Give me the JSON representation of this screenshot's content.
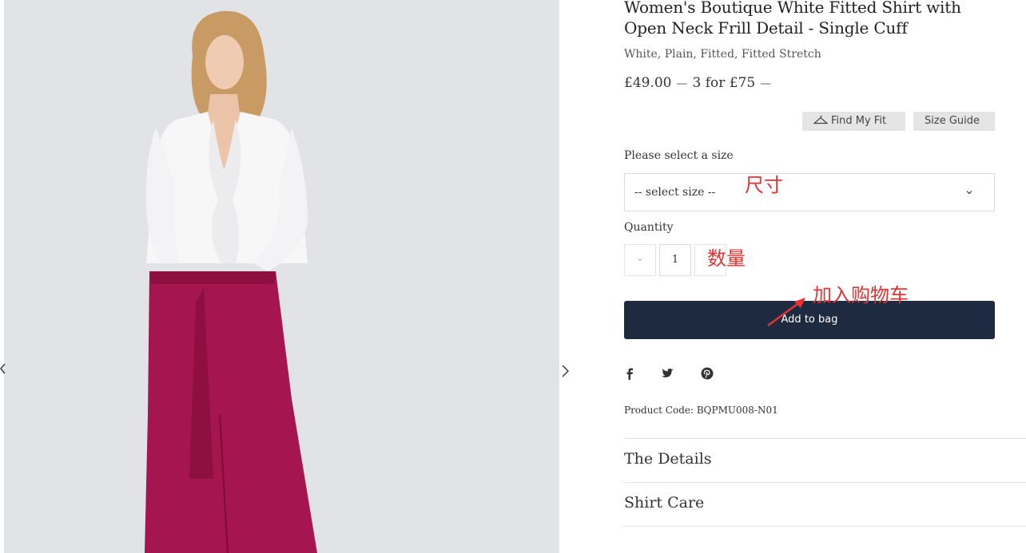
{
  "product": {
    "title": "Women's Boutique White Fitted Shirt with Open Neck Frill Detail - Single Cuff",
    "subtitle": "White, Plain, Fitted, Fitted Stretch",
    "price": "£49.00",
    "offer": "3 for £75",
    "dash": "—",
    "code": "Product Code: BQPMU008-N01"
  },
  "fit": {
    "find_my_fit": "Find My Fit",
    "size_guide": "Size Guide"
  },
  "size": {
    "label": "Please select a size",
    "placeholder": "-- select size --"
  },
  "quantity": {
    "label": "Quantity",
    "minus": "-",
    "value": "1",
    "plus": "+"
  },
  "cart": {
    "add_label": "Add to bag"
  },
  "social": [
    "facebook-icon",
    "twitter-icon",
    "pinterest-icon"
  ],
  "accordion": {
    "details": "The Details",
    "care": "Shirt Care"
  },
  "annotations": {
    "size": "尺寸",
    "quantity": "数量",
    "add_to_cart": "加入购物车"
  },
  "colors": {
    "button_navy": "#1e2a3f",
    "annotation_red": "#e63232",
    "image_bg": "#e2e3e7",
    "trousers": "#a5154f",
    "shirt": "#f7f7f8"
  }
}
